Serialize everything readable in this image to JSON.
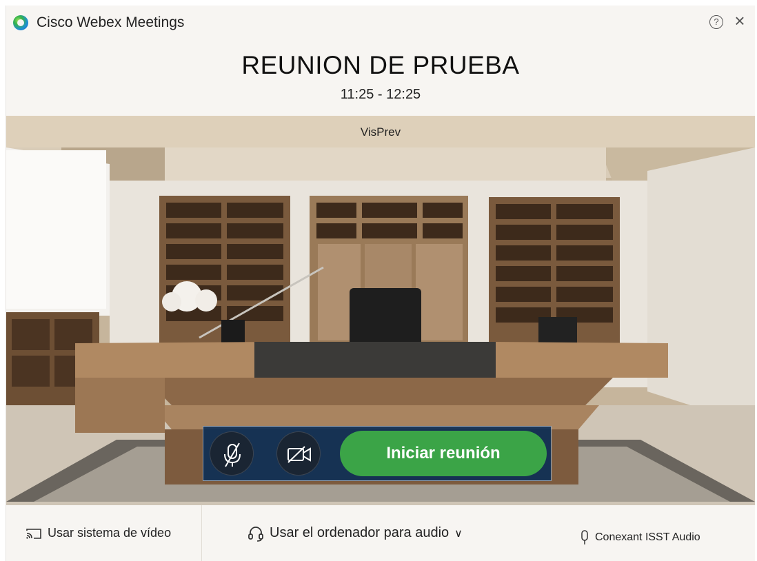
{
  "app": {
    "title": "Cisco Webex Meetings",
    "help_symbol": "?",
    "close_symbol": "×"
  },
  "meeting": {
    "title": "REUNION DE PRUEBA",
    "time": "11:25 - 12:25"
  },
  "preview": {
    "name": "VisPrev"
  },
  "controls": {
    "mic_icon": "mic-muted-icon",
    "camera_icon": "camera-off-icon",
    "start_label": "Iniciar reunión",
    "start_color": "#3ba447"
  },
  "bottom": {
    "video_system_label": "Usar sistema de vídeo",
    "audio_label": "Usar el ordenador para audio",
    "audio_chevron": "∨",
    "audio_device_label": "Conexant ISST Audio"
  }
}
